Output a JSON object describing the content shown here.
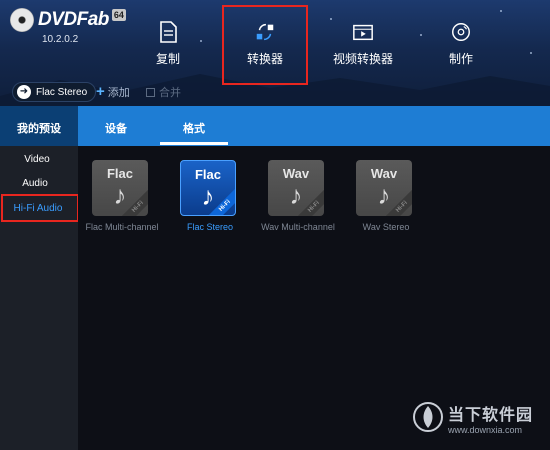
{
  "app": {
    "logo_text": "DVDFab",
    "logo_badge": "64",
    "version": "10.2.0.2"
  },
  "nav": {
    "items": [
      {
        "label": "复制",
        "icon": "document-icon"
      },
      {
        "label": "转换器",
        "icon": "convert-icon"
      },
      {
        "label": "视频转换器",
        "icon": "video-player-icon"
      },
      {
        "label": "制作",
        "icon": "disc-icon"
      }
    ],
    "selected": "转换器"
  },
  "profile_bar": {
    "current_profile": "Flac Stereo",
    "add_label": "添加",
    "merge_label": "合并"
  },
  "tabs": [
    {
      "label": "我的预设"
    },
    {
      "label": "设备"
    },
    {
      "label": "格式"
    }
  ],
  "active_tab": "格式",
  "sidebar": {
    "items": [
      {
        "label": "Video"
      },
      {
        "label": "Audio"
      },
      {
        "label": "Hi-Fi Audio"
      }
    ],
    "selected": "Hi-Fi Audio"
  },
  "formats": [
    {
      "thumb_title": "Flac",
      "label": "Flac Multi-channel",
      "badge": "Hi-Fi",
      "selected": false
    },
    {
      "thumb_title": "Flac",
      "label": "Flac Stereo",
      "badge": "Hi-Fi",
      "selected": true
    },
    {
      "thumb_title": "Wav",
      "label": "Wav Multi-channel",
      "badge": "Hi-Fi",
      "selected": false
    },
    {
      "thumb_title": "Wav",
      "label": "Wav Stereo",
      "badge": "Hi-Fi",
      "selected": false
    }
  ],
  "watermark": {
    "name": "当下软件园",
    "url": "www.downxia.com"
  },
  "colors": {
    "accent_blue": "#1e7dd4",
    "selected_text": "#3a9dff",
    "highlight_red": "#e8261f"
  }
}
